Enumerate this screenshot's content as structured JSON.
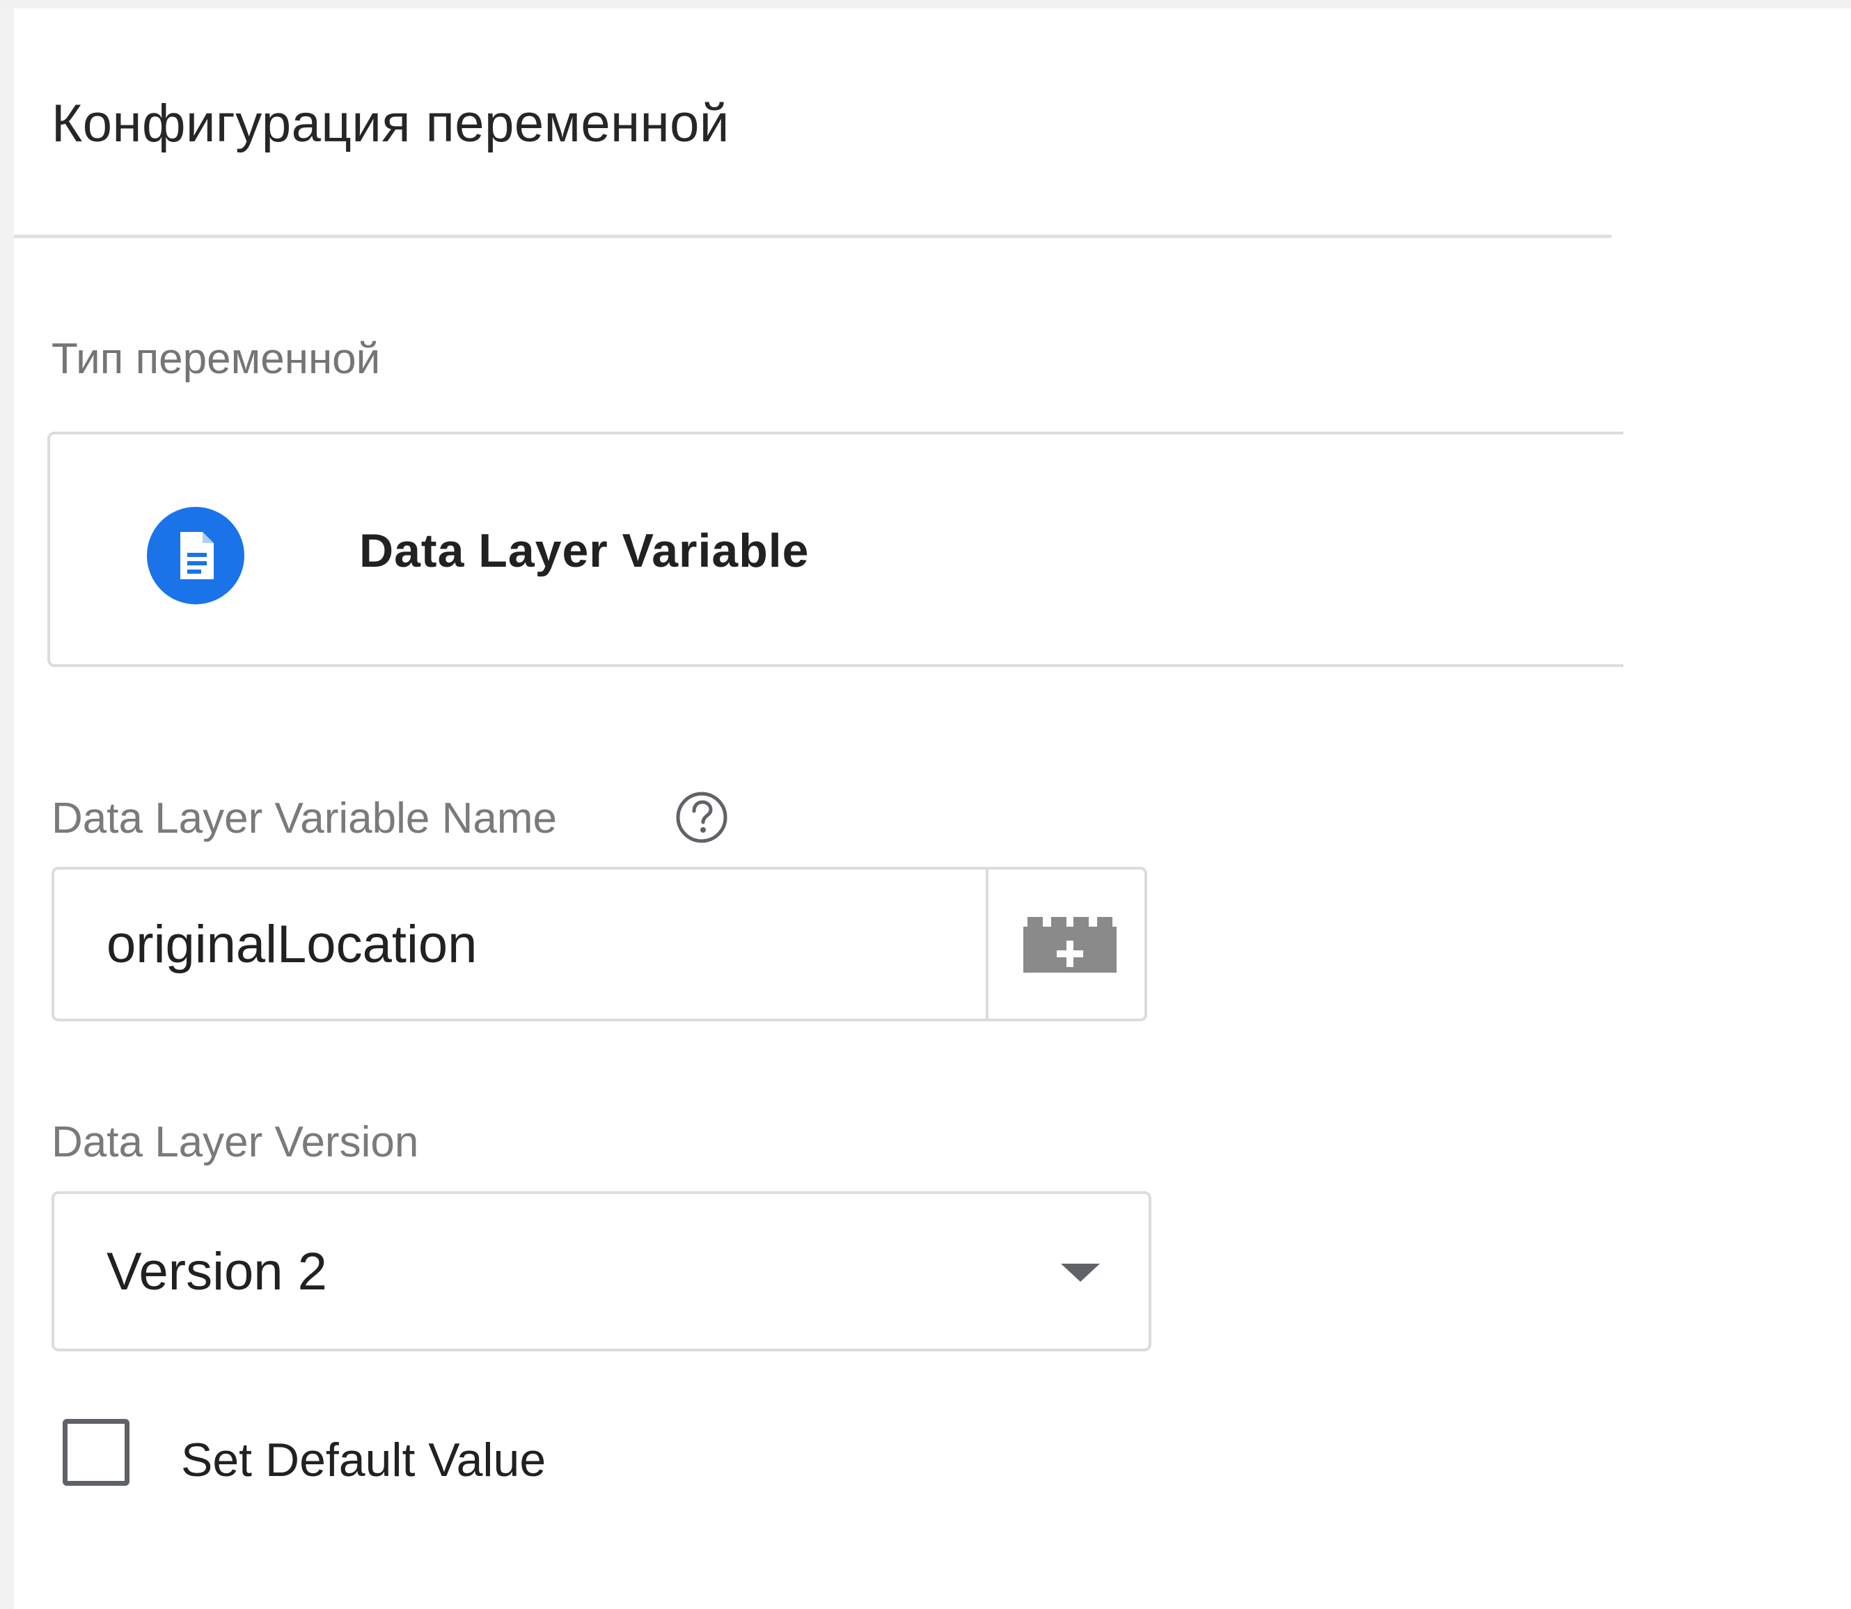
{
  "panel": {
    "title": "Конфигурация переменной"
  },
  "variable_type": {
    "section_label": "Тип переменной",
    "selected_type_name": "Data Layer Variable",
    "type_icon": "document-icon",
    "icon_color": "#1a73e8"
  },
  "name_field": {
    "label": "Data Layer Variable Name",
    "help_icon": "help-circle-icon",
    "value": "originalLocation",
    "action_icon": "insert-variable-icon"
  },
  "version_field": {
    "label": "Data Layer Version",
    "selected_value": "Version 2",
    "dropdown_icon": "dropdown-arrow-icon"
  },
  "default_value": {
    "label": "Set Default Value",
    "checked": false
  }
}
